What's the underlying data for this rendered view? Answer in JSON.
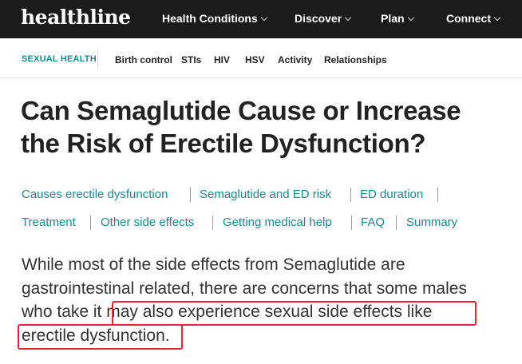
{
  "header": {
    "logo": "healthline",
    "nav": [
      {
        "label": "Health Conditions"
      },
      {
        "label": "Discover"
      },
      {
        "label": "Plan"
      },
      {
        "label": "Connect"
      }
    ]
  },
  "subnav": {
    "section": "SEXUAL HEALTH",
    "links": [
      "Birth control",
      "STIs",
      "HIV",
      "HSV",
      "Activity",
      "Relationships"
    ]
  },
  "article": {
    "title_line1": "Can Semaglutide Cause or Increase",
    "title_line2": "the Risk of Erectile Dysfunction?",
    "jump_links": [
      "Causes erectile dysfunction",
      "Semaglutide and ED risk",
      "ED duration",
      "Treatment",
      "Other side effects",
      "Getting medical help",
      "FAQ",
      "Summary"
    ],
    "paragraph_lines": [
      "While most of the side effects from Semaglutide are",
      "gastrointestinal related, there are concerns that some males",
      "who take it may also experience sexual side effects like",
      "erectile dysfunction."
    ]
  },
  "colors": {
    "topbar": "#1b1b1b",
    "accent": "#1a8a8a",
    "highlight_border": "#e8262b"
  }
}
